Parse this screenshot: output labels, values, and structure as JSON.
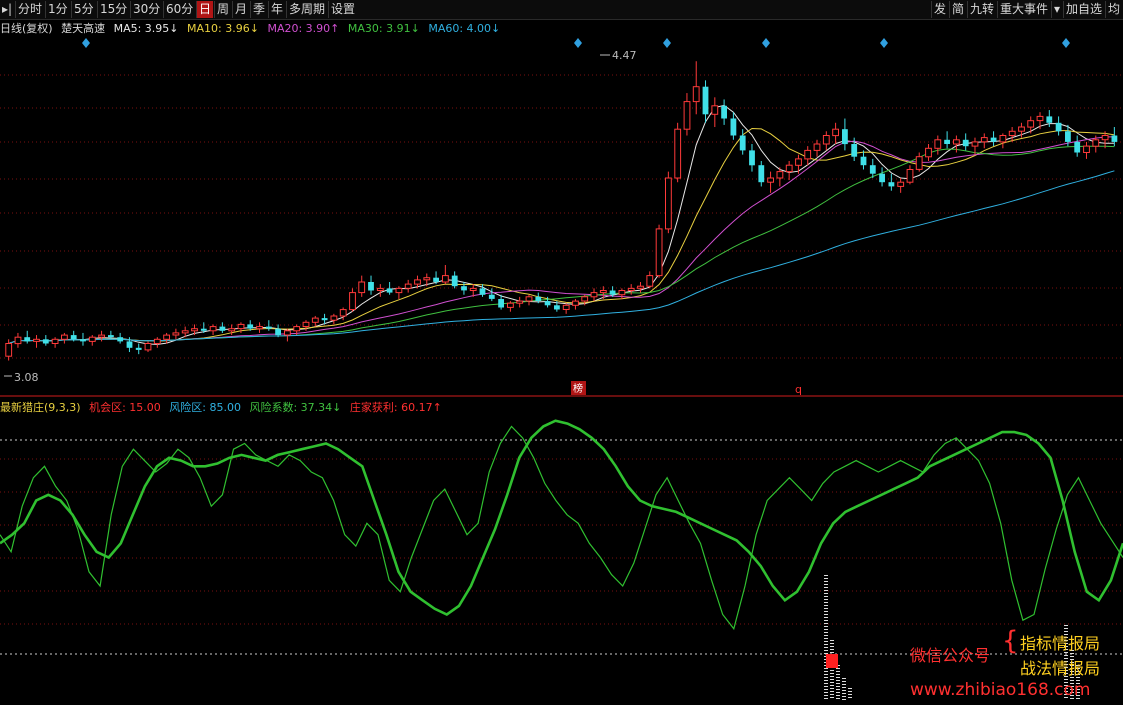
{
  "toolbar": {
    "left": [
      {
        "label": "▸|",
        "name": "play-toggle-icon"
      },
      {
        "label": "分时",
        "name": "tab-intraday"
      },
      {
        "label": "1分",
        "name": "tab-1min"
      },
      {
        "label": "5分",
        "name": "tab-5min"
      },
      {
        "label": "15分",
        "name": "tab-15min"
      },
      {
        "label": "30分",
        "name": "tab-30min"
      },
      {
        "label": "60分",
        "name": "tab-60min"
      },
      {
        "label": "日",
        "name": "tab-day",
        "active": true
      },
      {
        "label": "周",
        "name": "tab-week"
      },
      {
        "label": "月",
        "name": "tab-month"
      },
      {
        "label": "季",
        "name": "tab-quarter"
      },
      {
        "label": "年",
        "name": "tab-year"
      },
      {
        "label": "多周期",
        "name": "tab-multi-period"
      },
      {
        "label": "设置",
        "name": "tab-settings"
      }
    ],
    "right": [
      {
        "label": "发",
        "name": "btn-fa"
      },
      {
        "label": "简",
        "name": "btn-jian"
      },
      {
        "label": "九转",
        "name": "btn-jiuzhuan"
      },
      {
        "label": "重大事件",
        "name": "btn-major-events"
      },
      {
        "label": "▾",
        "name": "dropdown-caret-icon"
      },
      {
        "label": "加自选",
        "name": "btn-add-watchlist"
      },
      {
        "label": "均",
        "name": "btn-jun"
      }
    ]
  },
  "main_legend": {
    "period": "日线(复权)",
    "indicator": "楚天高速",
    "ma": [
      {
        "label": "MA5: 3.95↓",
        "color": "#e8e8e8"
      },
      {
        "label": "MA10: 3.96↓",
        "color": "#e8d040"
      },
      {
        "label": "MA20: 3.90↑",
        "color": "#d050d0"
      },
      {
        "label": "MA30: 3.91↓",
        "color": "#40c040"
      },
      {
        "label": "MA60: 4.00↓",
        "color": "#30b0e0"
      }
    ]
  },
  "sub_legend": [
    {
      "label": "最新猎庄(9,3,3)",
      "color": "#e8d040"
    },
    {
      "label": "机会区: 15.00",
      "color": "#ff3030"
    },
    {
      "label": "风险区: 85.00",
      "color": "#30b0e0"
    },
    {
      "label": "风险系数: 37.34↓",
      "color": "#40c040"
    },
    {
      "label": "庄家获利: 60.17↑",
      "color": "#ff3030"
    }
  ],
  "annotations": {
    "high_label": "4.47",
    "low_label": "3.08",
    "marker_bang": "榜",
    "marker_q": "q"
  },
  "watermark": {
    "wechat": "微信公众号",
    "name1": "指标情报局",
    "name2": "战法情报局",
    "url": "www.zhibiao168.com"
  },
  "colors": {
    "up": "#ff3a3a",
    "down": "#40e0e8",
    "grid": "#7a1010",
    "osc": "#30c030"
  },
  "chart_data": {
    "type": "candlestick",
    "price_range": [
      2.94,
      4.57
    ],
    "high": 4.47,
    "low": 3.08,
    "candles": [
      [
        3.08,
        3.16,
        3.06,
        3.14
      ],
      [
        3.14,
        3.19,
        3.12,
        3.17
      ],
      [
        3.17,
        3.2,
        3.14,
        3.15
      ],
      [
        3.15,
        3.18,
        3.12,
        3.16
      ],
      [
        3.16,
        3.18,
        3.13,
        3.14
      ],
      [
        3.14,
        3.17,
        3.12,
        3.16
      ],
      [
        3.16,
        3.19,
        3.14,
        3.18
      ],
      [
        3.18,
        3.2,
        3.15,
        3.16
      ],
      [
        3.16,
        3.19,
        3.13,
        3.15
      ],
      [
        3.15,
        3.18,
        3.13,
        3.17
      ],
      [
        3.17,
        3.2,
        3.15,
        3.18
      ],
      [
        3.18,
        3.2,
        3.16,
        3.17
      ],
      [
        3.17,
        3.19,
        3.14,
        3.15
      ],
      [
        3.15,
        3.17,
        3.1,
        3.12
      ],
      [
        3.12,
        3.14,
        3.09,
        3.11
      ],
      [
        3.11,
        3.15,
        3.1,
        3.14
      ],
      [
        3.14,
        3.17,
        3.12,
        3.16
      ],
      [
        3.16,
        3.19,
        3.14,
        3.18
      ],
      [
        3.18,
        3.21,
        3.16,
        3.19
      ],
      [
        3.19,
        3.22,
        3.17,
        3.2
      ],
      [
        3.2,
        3.23,
        3.18,
        3.21
      ],
      [
        3.21,
        3.24,
        3.19,
        3.2
      ],
      [
        3.2,
        3.23,
        3.18,
        3.22
      ],
      [
        3.22,
        3.24,
        3.19,
        3.2
      ],
      [
        3.2,
        3.23,
        3.18,
        3.21
      ],
      [
        3.21,
        3.24,
        3.19,
        3.23
      ],
      [
        3.23,
        3.25,
        3.2,
        3.21
      ],
      [
        3.21,
        3.24,
        3.19,
        3.22
      ],
      [
        3.22,
        3.25,
        3.2,
        3.21
      ],
      [
        3.21,
        3.23,
        3.17,
        3.18
      ],
      [
        3.18,
        3.21,
        3.15,
        3.2
      ],
      [
        3.2,
        3.23,
        3.18,
        3.22
      ],
      [
        3.22,
        3.25,
        3.2,
        3.24
      ],
      [
        3.24,
        3.27,
        3.22,
        3.26
      ],
      [
        3.26,
        3.28,
        3.23,
        3.25
      ],
      [
        3.25,
        3.28,
        3.23,
        3.27
      ],
      [
        3.27,
        3.31,
        3.25,
        3.3
      ],
      [
        3.3,
        3.4,
        3.29,
        3.38
      ],
      [
        3.38,
        3.46,
        3.36,
        3.43
      ],
      [
        3.43,
        3.46,
        3.37,
        3.39
      ],
      [
        3.39,
        3.42,
        3.36,
        3.4
      ],
      [
        3.4,
        3.43,
        3.37,
        3.38
      ],
      [
        3.38,
        3.41,
        3.35,
        3.4
      ],
      [
        3.4,
        3.44,
        3.38,
        3.42
      ],
      [
        3.42,
        3.46,
        3.4,
        3.44
      ],
      [
        3.44,
        3.47,
        3.41,
        3.45
      ],
      [
        3.45,
        3.48,
        3.42,
        3.43
      ],
      [
        3.43,
        3.51,
        3.42,
        3.46
      ],
      [
        3.46,
        3.48,
        3.4,
        3.41
      ],
      [
        3.41,
        3.43,
        3.37,
        3.39
      ],
      [
        3.39,
        3.42,
        3.36,
        3.4
      ],
      [
        3.4,
        3.42,
        3.36,
        3.37
      ],
      [
        3.37,
        3.4,
        3.34,
        3.35
      ],
      [
        3.35,
        3.37,
        3.3,
        3.31
      ],
      [
        3.31,
        3.34,
        3.29,
        3.33
      ],
      [
        3.33,
        3.36,
        3.31,
        3.34
      ],
      [
        3.34,
        3.37,
        3.32,
        3.36
      ],
      [
        3.36,
        3.38,
        3.33,
        3.34
      ],
      [
        3.34,
        3.36,
        3.31,
        3.32
      ],
      [
        3.32,
        3.34,
        3.29,
        3.3
      ],
      [
        3.3,
        3.33,
        3.28,
        3.32
      ],
      [
        3.32,
        3.35,
        3.3,
        3.34
      ],
      [
        3.34,
        3.37,
        3.32,
        3.36
      ],
      [
        3.36,
        3.4,
        3.34,
        3.38
      ],
      [
        3.38,
        3.41,
        3.35,
        3.39
      ],
      [
        3.39,
        3.41,
        3.36,
        3.37
      ],
      [
        3.37,
        3.4,
        3.35,
        3.39
      ],
      [
        3.39,
        3.42,
        3.37,
        3.4
      ],
      [
        3.4,
        3.43,
        3.38,
        3.41
      ],
      [
        3.41,
        3.48,
        3.4,
        3.46
      ],
      [
        3.46,
        3.7,
        3.45,
        3.68
      ],
      [
        3.68,
        3.95,
        3.66,
        3.92
      ],
      [
        3.92,
        4.18,
        3.9,
        4.15
      ],
      [
        4.15,
        4.32,
        4.12,
        4.28
      ],
      [
        4.28,
        4.47,
        4.22,
        4.35
      ],
      [
        4.35,
        4.38,
        4.18,
        4.22
      ],
      [
        4.22,
        4.3,
        4.16,
        4.26
      ],
      [
        4.26,
        4.29,
        4.17,
        4.2
      ],
      [
        4.2,
        4.23,
        4.1,
        4.12
      ],
      [
        4.12,
        4.15,
        4.03,
        4.05
      ],
      [
        4.05,
        4.08,
        3.95,
        3.98
      ],
      [
        3.98,
        4.0,
        3.88,
        3.9
      ],
      [
        3.9,
        3.95,
        3.85,
        3.92
      ],
      [
        3.92,
        3.97,
        3.88,
        3.95
      ],
      [
        3.95,
        4.0,
        3.91,
        3.98
      ],
      [
        3.98,
        4.03,
        3.94,
        4.01
      ],
      [
        4.01,
        4.07,
        3.98,
        4.05
      ],
      [
        4.05,
        4.1,
        4.02,
        4.08
      ],
      [
        4.08,
        4.14,
        4.05,
        4.12
      ],
      [
        4.12,
        4.18,
        4.08,
        4.15
      ],
      [
        4.15,
        4.2,
        4.05,
        4.08
      ],
      [
        4.08,
        4.11,
        4.0,
        4.02
      ],
      [
        4.02,
        4.05,
        3.96,
        3.98
      ],
      [
        3.98,
        4.01,
        3.92,
        3.94
      ],
      [
        3.94,
        3.97,
        3.88,
        3.9
      ],
      [
        3.9,
        3.94,
        3.86,
        3.88
      ],
      [
        3.88,
        3.92,
        3.85,
        3.9
      ],
      [
        3.9,
        3.98,
        3.89,
        3.96
      ],
      [
        3.96,
        4.04,
        3.95,
        4.02
      ],
      [
        4.02,
        4.08,
        4.0,
        4.06
      ],
      [
        4.06,
        4.12,
        4.03,
        4.1
      ],
      [
        4.1,
        4.14,
        4.06,
        4.08
      ],
      [
        4.08,
        4.12,
        4.04,
        4.1
      ],
      [
        4.1,
        4.13,
        4.05,
        4.07
      ],
      [
        4.07,
        4.11,
        4.03,
        4.09
      ],
      [
        4.09,
        4.13,
        4.06,
        4.11
      ],
      [
        4.11,
        4.14,
        4.07,
        4.09
      ],
      [
        4.09,
        4.13,
        4.06,
        4.12
      ],
      [
        4.12,
        4.16,
        4.09,
        4.14
      ],
      [
        4.14,
        4.18,
        4.11,
        4.16
      ],
      [
        4.16,
        4.21,
        4.13,
        4.19
      ],
      [
        4.19,
        4.23,
        4.15,
        4.21
      ],
      [
        4.21,
        4.24,
        4.16,
        4.18
      ],
      [
        4.18,
        4.21,
        4.12,
        4.14
      ],
      [
        4.14,
        4.17,
        4.07,
        4.09
      ],
      [
        4.09,
        4.12,
        4.02,
        4.04
      ],
      [
        4.04,
        4.09,
        4.01,
        4.07
      ],
      [
        4.07,
        4.12,
        4.04,
        4.1
      ],
      [
        4.1,
        4.14,
        4.06,
        4.12
      ],
      [
        4.12,
        4.16,
        4.07,
        4.09
      ]
    ],
    "oscillator": {
      "range": [
        0,
        100
      ],
      "opportunity_zone": 15.0,
      "risk_zone": 85.0,
      "risk_coefficient": 37.34,
      "dealer_profit": 60.17,
      "slow": [
        55,
        58,
        62,
        70,
        72,
        70,
        65,
        58,
        52,
        50,
        55,
        65,
        75,
        82,
        85,
        84,
        82,
        82,
        83,
        85,
        86,
        85,
        84,
        86,
        87,
        88,
        89,
        90,
        88,
        85,
        82,
        70,
        58,
        45,
        38,
        35,
        32,
        30,
        33,
        40,
        50,
        60,
        72,
        85,
        92,
        96,
        98,
        97,
        95,
        92,
        88,
        82,
        75,
        70,
        68,
        67,
        66,
        64,
        62,
        60,
        58,
        56,
        52,
        47,
        40,
        35,
        38,
        45,
        55,
        62,
        66,
        68,
        70,
        72,
        74,
        76,
        78,
        82,
        84,
        86,
        88,
        90,
        92,
        94,
        94,
        93,
        90,
        85,
        70,
        52,
        38,
        35,
        42,
        55
      ],
      "fast": [
        58,
        52,
        68,
        78,
        82,
        75,
        70,
        60,
        45,
        40,
        65,
        82,
        88,
        84,
        80,
        83,
        88,
        85,
        78,
        68,
        72,
        88,
        90,
        86,
        84,
        82,
        86,
        84,
        80,
        78,
        70,
        58,
        54,
        62,
        58,
        42,
        38,
        50,
        60,
        70,
        74,
        66,
        58,
        62,
        80,
        90,
        96,
        92,
        85,
        76,
        70,
        65,
        62,
        55,
        50,
        44,
        40,
        48,
        60,
        72,
        78,
        70,
        62,
        55,
        42,
        30,
        25,
        40,
        58,
        70,
        74,
        78,
        74,
        70,
        76,
        80,
        82,
        84,
        82,
        80,
        82,
        84,
        82,
        80,
        86,
        90,
        92,
        88,
        84,
        76,
        62,
        42,
        28,
        30,
        46,
        60,
        72,
        78,
        70,
        62,
        56,
        50
      ]
    }
  }
}
